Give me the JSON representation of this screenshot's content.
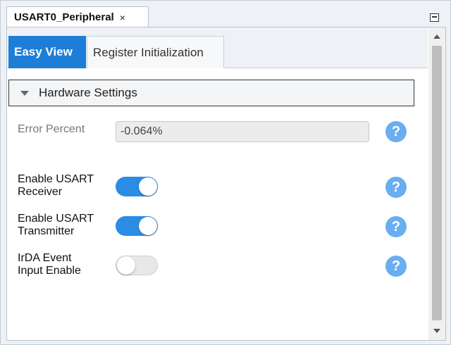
{
  "doc_tab": {
    "title": "USART0_Peripheral",
    "close_glyph": "×"
  },
  "tabs": [
    {
      "label": "Easy View",
      "active": true
    },
    {
      "label": "Register Initialization",
      "active": false
    }
  ],
  "section": {
    "title": "Hardware Settings",
    "expanded": true
  },
  "error_percent": {
    "label": "Error Percent",
    "value": "-0.064%"
  },
  "settings": [
    {
      "label_line1": "Enable USART",
      "label_line2": "Receiver",
      "on": true
    },
    {
      "label_line1": "Enable USART",
      "label_line2": "Transmitter",
      "on": true
    },
    {
      "label_line1": "IrDA Event",
      "label_line2": "Input Enable",
      "on": false
    }
  ],
  "help_glyph": "?",
  "colors": {
    "accent": "#1d7ed8",
    "toggle_on": "#2b8ce3",
    "help": "#6aaef2"
  }
}
